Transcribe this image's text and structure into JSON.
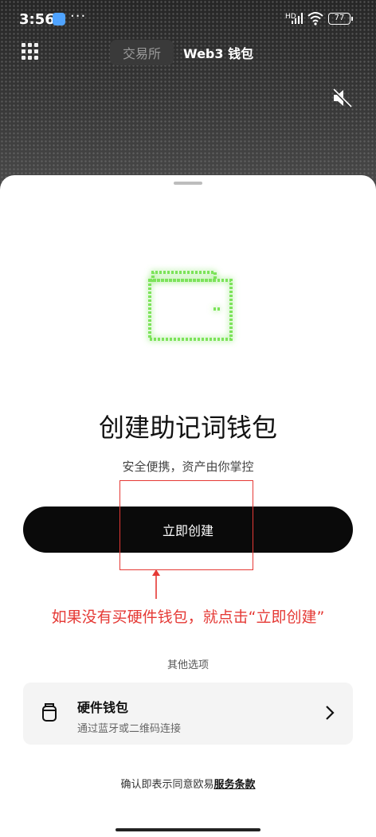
{
  "status_bar": {
    "time": "3:56",
    "dots": "···",
    "signal_label": "HD",
    "battery": "77"
  },
  "header": {
    "tabs": [
      {
        "label": "交易所"
      },
      {
        "label": "Web3 钱包"
      }
    ],
    "menu_icon": "grid-icon",
    "mute_icon": "speaker-mute-icon"
  },
  "sheet": {
    "title": "创建助记词钱包",
    "subtitle": "安全便携，资产由你掌控",
    "primary_button": "立即创建",
    "annotation": "如果没有买硬件钱包，就点击“立即创建”",
    "other_options_label": "其他选项",
    "hardware_option": {
      "title": "硬件钱包",
      "subtitle": "通过蓝牙或二维码连接",
      "icon": "hardware-wallet-icon"
    },
    "terms_prefix": "确认即表示同意欧易",
    "terms_link": "服务条款"
  },
  "colors": {
    "accent_green": "#7be35a",
    "annotation_red": "#e53935",
    "button_bg": "#0a0a0a"
  }
}
